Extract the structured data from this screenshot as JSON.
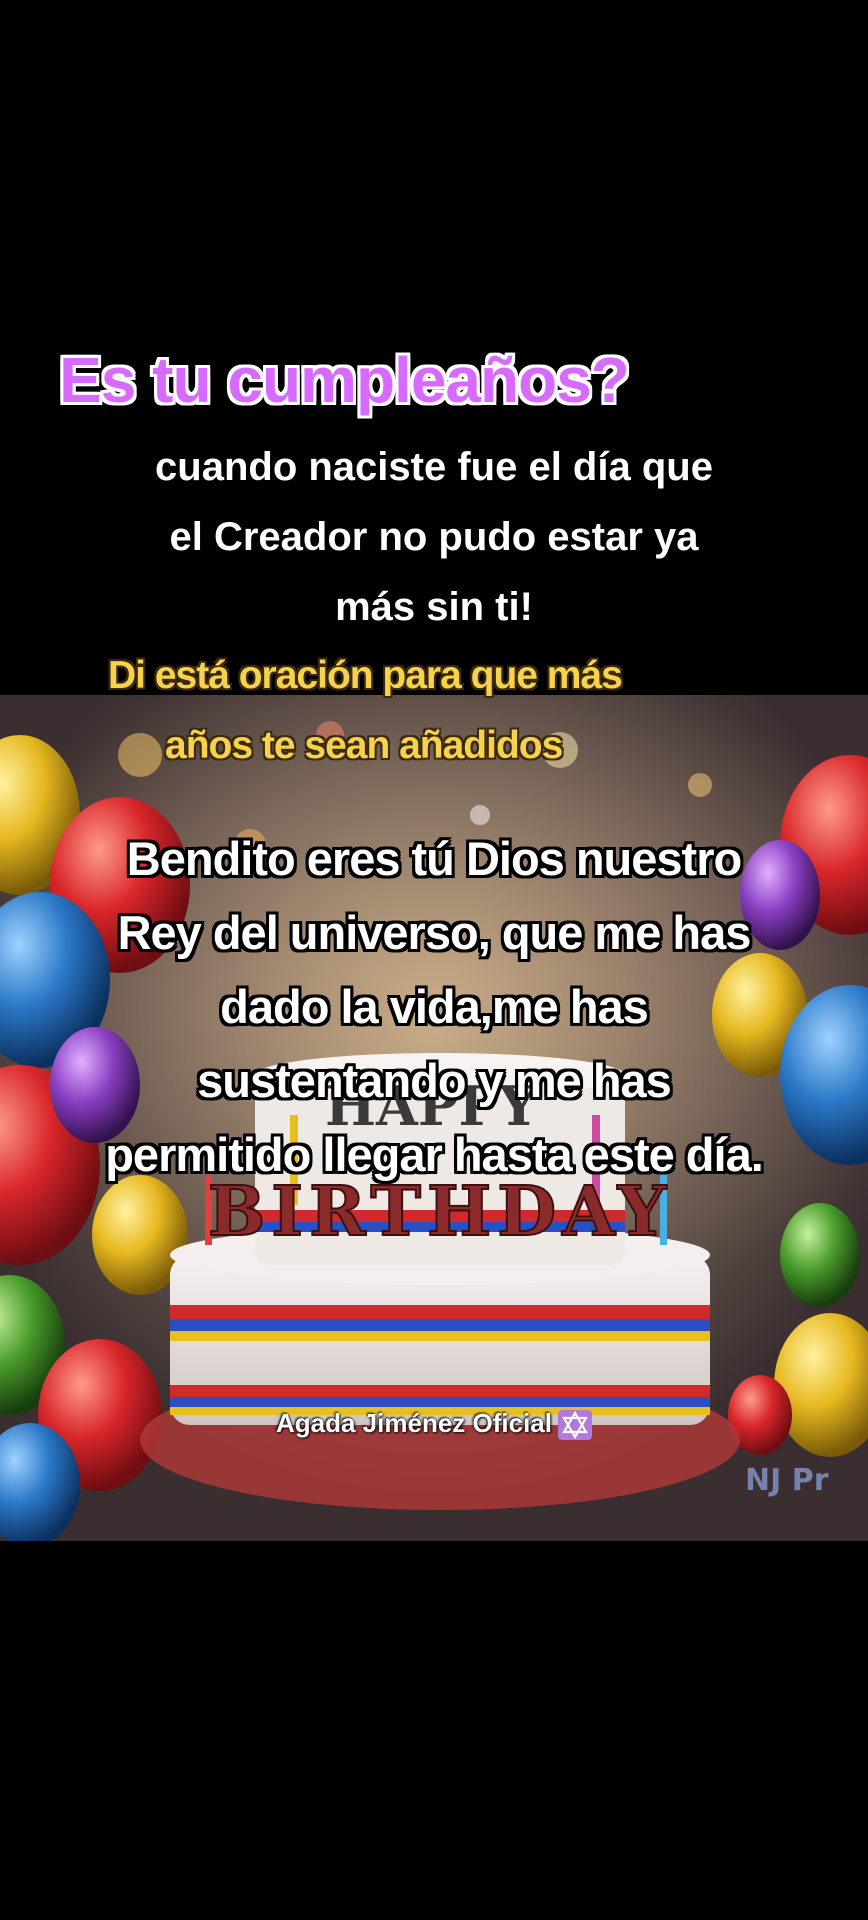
{
  "heading": "Es tu cumpleaños?",
  "intro_lines": [
    "cuando naciste fue el día que",
    "el Creador no pudo estar ya",
    "más sin ti!"
  ],
  "prompt_lines": [
    "Di está oración para que más",
    "años  te sean añadidos"
  ],
  "prayer_lines": [
    "Bendito eres tú Dios nuestro",
    "Rey del universo, que me  has",
    "dado la vida,me has",
    "sustentando y me has",
    "permitido llegar hasta este día."
  ],
  "cake_text": "BIRTHDAY",
  "watermark": "Agada Jiménez Oficial",
  "watermark_icon": "star-of-david-icon",
  "colors": {
    "heading": "#d86bff",
    "prompt": "#f7d24a",
    "text": "#ffffff",
    "background": "#000000"
  }
}
